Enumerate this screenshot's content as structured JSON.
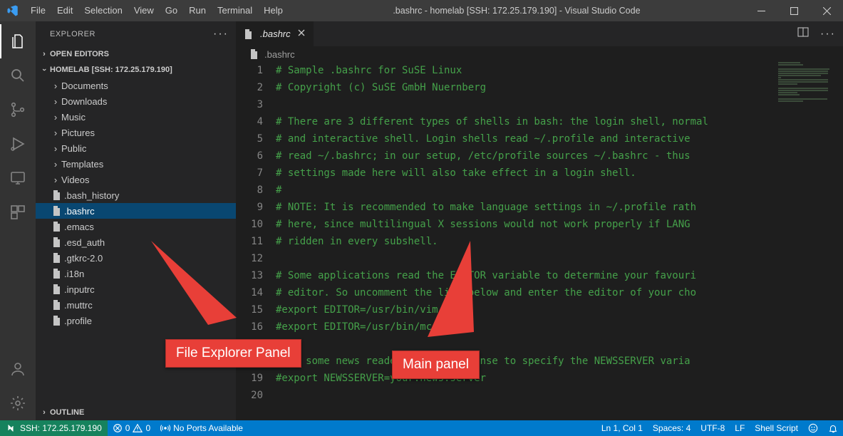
{
  "titlebar": {
    "title": ".bashrc - homelab [SSH: 172.25.179.190] - Visual Studio Code",
    "menu": [
      "File",
      "Edit",
      "Selection",
      "View",
      "Go",
      "Run",
      "Terminal",
      "Help"
    ]
  },
  "sidebar": {
    "title": "EXPLORER",
    "sections": {
      "openEditors": "OPEN EDITORS",
      "workspace": "HOMELAB [SSH: 172.25.179.190]",
      "outline": "OUTLINE"
    },
    "tree": [
      {
        "type": "folder",
        "name": "Documents"
      },
      {
        "type": "folder",
        "name": "Downloads"
      },
      {
        "type": "folder",
        "name": "Music"
      },
      {
        "type": "folder",
        "name": "Pictures"
      },
      {
        "type": "folder",
        "name": "Public"
      },
      {
        "type": "folder",
        "name": "Templates"
      },
      {
        "type": "folder",
        "name": "Videos"
      },
      {
        "type": "file",
        "name": ".bash_history"
      },
      {
        "type": "file",
        "name": ".bashrc",
        "selected": true
      },
      {
        "type": "file",
        "name": ".emacs"
      },
      {
        "type": "file",
        "name": ".esd_auth"
      },
      {
        "type": "file",
        "name": ".gtkrc-2.0"
      },
      {
        "type": "file",
        "name": ".i18n"
      },
      {
        "type": "file",
        "name": ".inputrc"
      },
      {
        "type": "file",
        "name": ".muttrc"
      },
      {
        "type": "file",
        "name": ".profile"
      }
    ]
  },
  "tabs": {
    "active": {
      "name": ".bashrc"
    },
    "breadcrumb": ".bashrc"
  },
  "code_lines": [
    "# Sample .bashrc for SuSE Linux",
    "# Copyright (c) SuSE GmbH Nuernberg",
    "",
    "# There are 3 different types of shells in bash: the login shell, normal",
    "# and interactive shell. Login shells read ~/.profile and interactive ",
    "# read ~/.bashrc; in our setup, /etc/profile sources ~/.bashrc - thus ",
    "# settings made here will also take effect in a login shell.",
    "#",
    "# NOTE: It is recommended to make language settings in ~/.profile rath",
    "# here, since multilingual X sessions would not work properly if LANG ",
    "# ridden in every subshell.",
    "",
    "# Some applications read the EDITOR variable to determine your favouri",
    "# editor. So uncomment the line below and enter the editor of your cho",
    "#export EDITOR=/usr/bin/vim",
    "#export EDITOR=/usr/bin/mcedit",
    "",
    "#For some news readers it makes sense to specify the NEWSSERVER varia",
    "#export NEWSSERVER=your.news.server",
    ""
  ],
  "status": {
    "remote": "SSH: 172.25.179.190",
    "errors": "0",
    "warnings": "0",
    "ports": "No Ports Available",
    "cursor": "Ln 1, Col 1",
    "spaces": "Spaces: 4",
    "encoding": "UTF-8",
    "eol": "LF",
    "lang": "Shell Script"
  },
  "annotations": {
    "left": "File Explorer Panel",
    "right": "Main panel"
  }
}
